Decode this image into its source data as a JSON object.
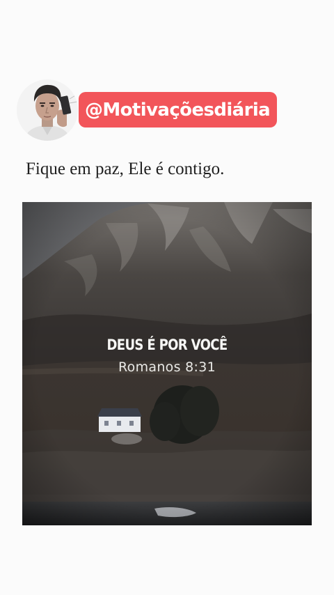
{
  "post": {
    "handle": "@Motivaçõesdiária",
    "caption": "Fique em paz, Ele é contigo.",
    "avatar_icon": "profile-photo",
    "badge_color": "#f2555a"
  },
  "image": {
    "title": "DEUS É POR VOCÊ",
    "reference": "Romanos 8:31"
  }
}
